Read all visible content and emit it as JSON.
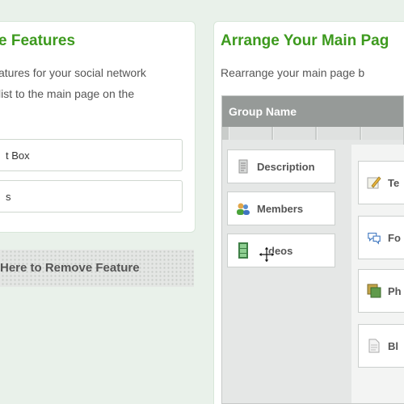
{
  "left_panel": {
    "title": "e Features",
    "desc_line1": "atures for your social network",
    "desc_line2": "list to the main page on the",
    "features": [
      {
        "label": "t Box"
      },
      {
        "label": "s"
      }
    ],
    "remove_zone_label": "Here to Remove Feature"
  },
  "right_panel": {
    "title": "Arrange Your Main Pag",
    "desc": "Rearrange your main page b",
    "group_name": "Group Name",
    "left_column": [
      {
        "label": "Description",
        "icon": "description-icon"
      },
      {
        "label": "Members",
        "icon": "members-icon"
      },
      {
        "label": "deos",
        "icon": "videos-icon"
      }
    ],
    "right_column": [
      {
        "label": "Te",
        "icon": "text-edit-icon"
      },
      {
        "label": "Fo",
        "icon": "forum-icon"
      },
      {
        "label": "Ph",
        "icon": "photos-icon"
      },
      {
        "label": "Bl",
        "icon": "blog-icon"
      }
    ]
  },
  "colors": {
    "title_green": "#3d9a1e",
    "group_bar": "#969a98",
    "background": "#e9f1ea"
  }
}
